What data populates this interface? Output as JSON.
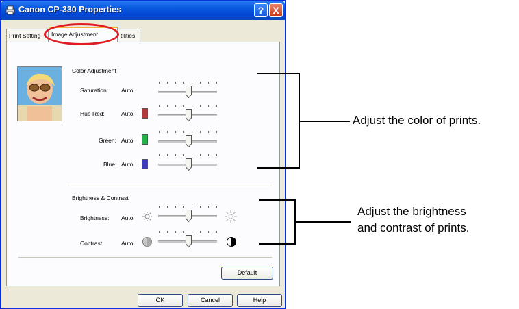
{
  "window": {
    "title": "Canon CP-330 Properties",
    "help_button": "?",
    "close_button": "X"
  },
  "tabs": {
    "print_settings": "Print Setting",
    "image_adjustment": "Image Adjustment",
    "utilities": "tilities"
  },
  "color_adjustment": {
    "heading": "Color Adjustment",
    "rows": [
      {
        "label": "Saturation:",
        "value": "Auto"
      },
      {
        "label": "Hue  Red:",
        "value": "Auto",
        "swatch": "#b23a3a"
      },
      {
        "label": "Green:",
        "value": "Auto",
        "swatch": "#22b24a"
      },
      {
        "label": "Blue:",
        "value": "Auto",
        "swatch": "#3c3cb4"
      }
    ]
  },
  "brightness_contrast": {
    "heading": "Brightness & Contrast",
    "rows": [
      {
        "label": "Brightness:",
        "value": "Auto"
      },
      {
        "label": "Contrast:",
        "value": "Auto"
      }
    ]
  },
  "buttons": {
    "default": "Default",
    "ok": "OK",
    "cancel": "Cancel",
    "help": "Help"
  },
  "callouts": {
    "color": "Adjust the color of prints.",
    "brightness_line1": "Adjust the brightness",
    "brightness_line2": "and contrast of prints."
  },
  "colors": {
    "highlight": "#e01c24",
    "titlebar": "#0a5ce0"
  }
}
